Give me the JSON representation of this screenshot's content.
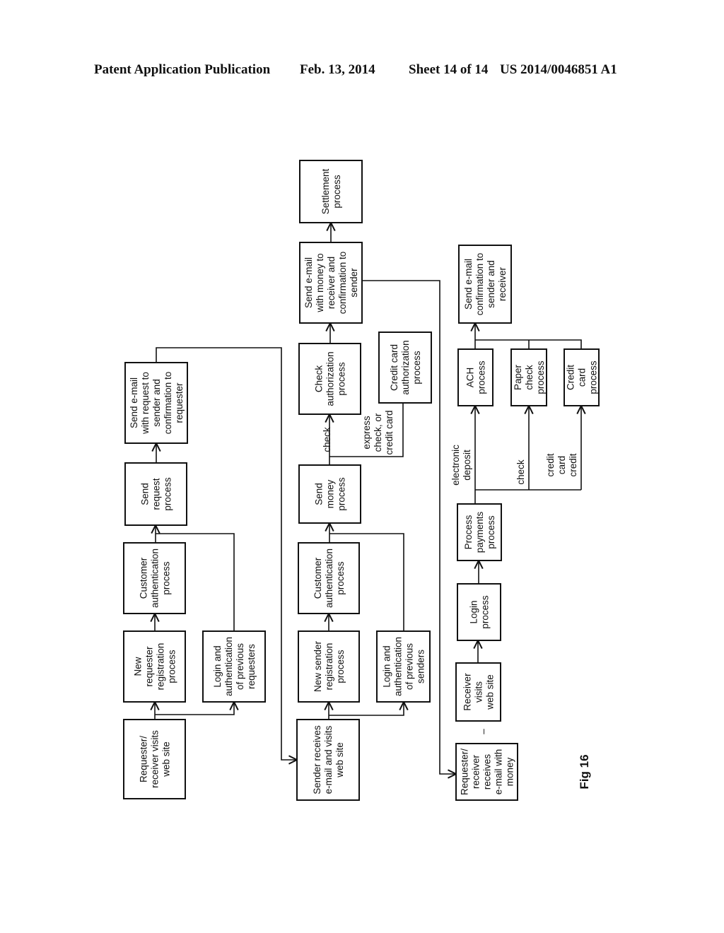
{
  "header": {
    "publication": "Patent Application Publication",
    "date": "Feb. 13, 2014",
    "sheet": "Sheet 14 of 14",
    "number": "US 2014/0046851 A1"
  },
  "figure_label": "Fig 16",
  "flowchart": {
    "request_flow": {
      "requester_visits": [
        "Requester/",
        "receiver visits",
        "web site"
      ],
      "new_requester_registration": [
        "New",
        "requester",
        "registration",
        "process"
      ],
      "login_previous_requesters": [
        "Login and",
        "authentication",
        "of previous",
        "requesters"
      ],
      "customer_auth_1": [
        "Customer",
        "authentication",
        "process"
      ],
      "send_request": [
        "Send",
        "request",
        "process"
      ],
      "send_email_request": [
        "Send e-mail",
        "with request to",
        "sender and",
        "confirmation to",
        "requester"
      ]
    },
    "send_flow": {
      "sender_receives": [
        "Sender receives",
        "e-mail and visits",
        "web site"
      ],
      "new_sender_registration": [
        "New sender",
        "registration",
        "process"
      ],
      "login_previous_senders": [
        "Login and",
        "authentication",
        "of previous",
        "senders"
      ],
      "customer_auth_2": [
        "Customer",
        "authentication",
        "process"
      ],
      "send_money": [
        "Send",
        "money",
        "process"
      ],
      "check_authorization": [
        "Check",
        "authorization",
        "process"
      ],
      "credit_card_authorization": [
        "Credit card",
        "authorization",
        "process"
      ],
      "send_email_money": [
        "Send e-mail",
        "with money to",
        "receiver and",
        "confirmation to",
        "sender"
      ],
      "settlement": [
        "Settlement",
        "process"
      ],
      "label_check": [
        "check"
      ],
      "label_express": [
        "express",
        "check, or",
        "credit card"
      ]
    },
    "receive_flow": {
      "requester_receives": [
        "Requester/",
        "receiver",
        "receives",
        "e-mail with",
        "money"
      ],
      "receiver_visits": [
        "Receiver",
        "visits",
        "web site"
      ],
      "login_process": [
        "Login",
        "process"
      ],
      "process_payments": [
        "Process",
        "payments",
        "process"
      ],
      "ach": [
        "ACH",
        "process"
      ],
      "paper_check": [
        "Paper",
        "check",
        "process"
      ],
      "credit_card_process": [
        "Credit",
        "card",
        "process"
      ],
      "send_email_confirmation": [
        "Send e-mail",
        "confirmation to",
        "sender and",
        "receiver"
      ],
      "label_electronic": [
        "electronic",
        "deposit"
      ],
      "label_check": [
        "check"
      ],
      "label_credit": [
        "credit",
        "card",
        "credit"
      ],
      "dash_mark": [
        "–"
      ]
    }
  }
}
